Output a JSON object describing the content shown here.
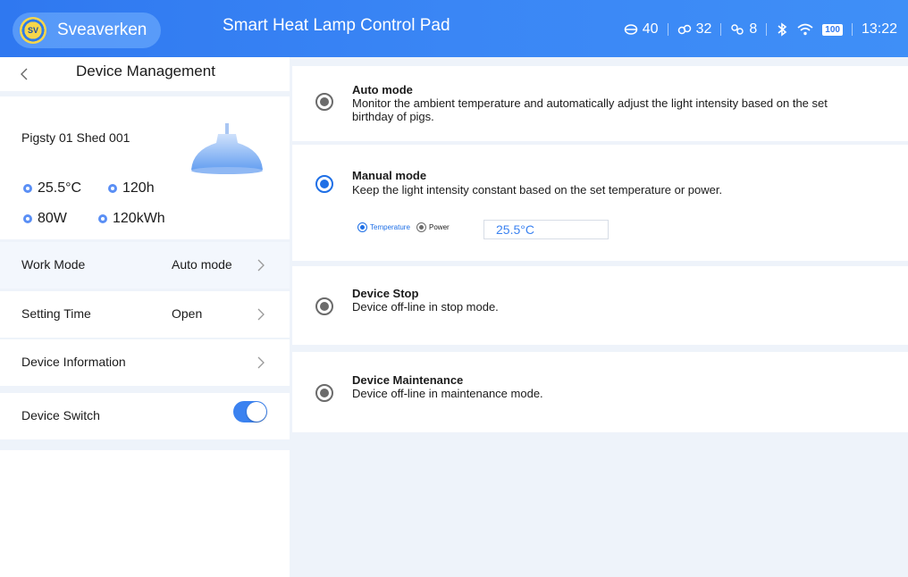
{
  "header": {
    "brand": "Sveaverken",
    "logo_text": "SV",
    "title": "Smart Heat Lamp Control Pad",
    "status": {
      "gateway_count": "40",
      "link_count": "32",
      "group_count": "8",
      "battery": "100",
      "time": "13:22"
    }
  },
  "sidebar": {
    "title": "Device Management",
    "device_name": "Pigsty 01 Shed 001",
    "stats": {
      "temperature": "25.5°C",
      "hours": "120h",
      "power": "80W",
      "energy": "120kWh"
    },
    "rows": [
      {
        "label": "Work Mode",
        "value": "Auto mode"
      },
      {
        "label": "Setting Time",
        "value": "Open"
      },
      {
        "label": "Device Information",
        "value": ""
      },
      {
        "label": "Device Switch",
        "value": ""
      }
    ],
    "device_switch_on": true
  },
  "modes": {
    "auto": {
      "title": "Auto mode",
      "desc": "Monitor the ambient temperature and automatically adjust the light intensity based on the set birthday of pigs."
    },
    "manual": {
      "title": "Manual mode",
      "desc": "Keep the light intensity constant based on the set temperature or power.",
      "option_temperature": "Temperature",
      "option_power": "Power",
      "value": "25.5°C"
    },
    "stop": {
      "title": "Device Stop",
      "desc": "Device off-line in stop mode."
    },
    "maintenance": {
      "title": "Device Maintenance",
      "desc": "Device off-line in maintenance mode."
    },
    "selected": "manual"
  },
  "colors": {
    "accent": "#3b82f0",
    "header_bg": "#2f78f0",
    "background": "#eef3fa"
  }
}
